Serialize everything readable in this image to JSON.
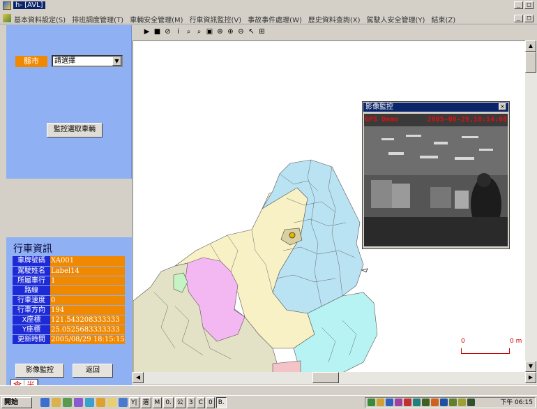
{
  "window": {
    "title": "[AVL]",
    "title_prefix": "h-",
    "controls": [
      "_",
      "□",
      "×"
    ]
  },
  "menu": {
    "items": [
      "基本資料設定(S)",
      "排班調度管理(T)",
      "車輛安全管理(M)",
      "行車資訊監控(V)",
      "事故事件處理(W)",
      "歷史資料查詢(X)",
      "駕駛人安全管理(Y)",
      "結束(Z)"
    ]
  },
  "search": {
    "city_label": "縣市",
    "city_value": "請選擇",
    "select_vehicle_button": "監控選取車輛"
  },
  "info": {
    "title": "行車資訊",
    "rows": [
      {
        "label": "車牌號碼",
        "value": "XA001"
      },
      {
        "label": "駕駛姓名",
        "value": "Label14"
      },
      {
        "label": "所屬車行",
        "value": "1"
      },
      {
        "label": "路線",
        "value": ""
      },
      {
        "label": "行車速度",
        "value": "0"
      },
      {
        "label": "行車方向",
        "value": "194"
      },
      {
        "label": "X座標",
        "value": "121.543208333333"
      },
      {
        "label": "Y座標",
        "value": "25.0525683333333"
      },
      {
        "label": "更新時間",
        "value": "2005/08/29 18:15:15"
      }
    ],
    "video_button": "影像監控",
    "back_button": "返回"
  },
  "ime": {
    "chars": [
      "倉",
      "半"
    ]
  },
  "map": {
    "tools": [
      "▶",
      "■",
      "⊘",
      "i",
      "⌕",
      "⌕",
      "▣",
      "⊕",
      "⊕",
      "⊖",
      "↖",
      "⊞"
    ],
    "scale_zero": "0",
    "scale_unit": "0 m",
    "colors": {
      "light_blue": "#b9e3f3",
      "pale_yellow": "#f7f1c5",
      "pink": "#f3b7f1",
      "khaki": "#e3e1c6",
      "cyan": "#b7f3f3",
      "light_green": "#c5f3c3"
    }
  },
  "video": {
    "title": "影像監控",
    "overlay_left": "GPS Demo",
    "overlay_right": "2005-08-29,18:14:08",
    "close": "×"
  },
  "taskbar": {
    "start": "開始",
    "items": [
      "Y|",
      "選",
      "M",
      "0.",
      "公",
      "3",
      "C",
      "0",
      "B."
    ],
    "clock": "下午 06:15"
  }
}
